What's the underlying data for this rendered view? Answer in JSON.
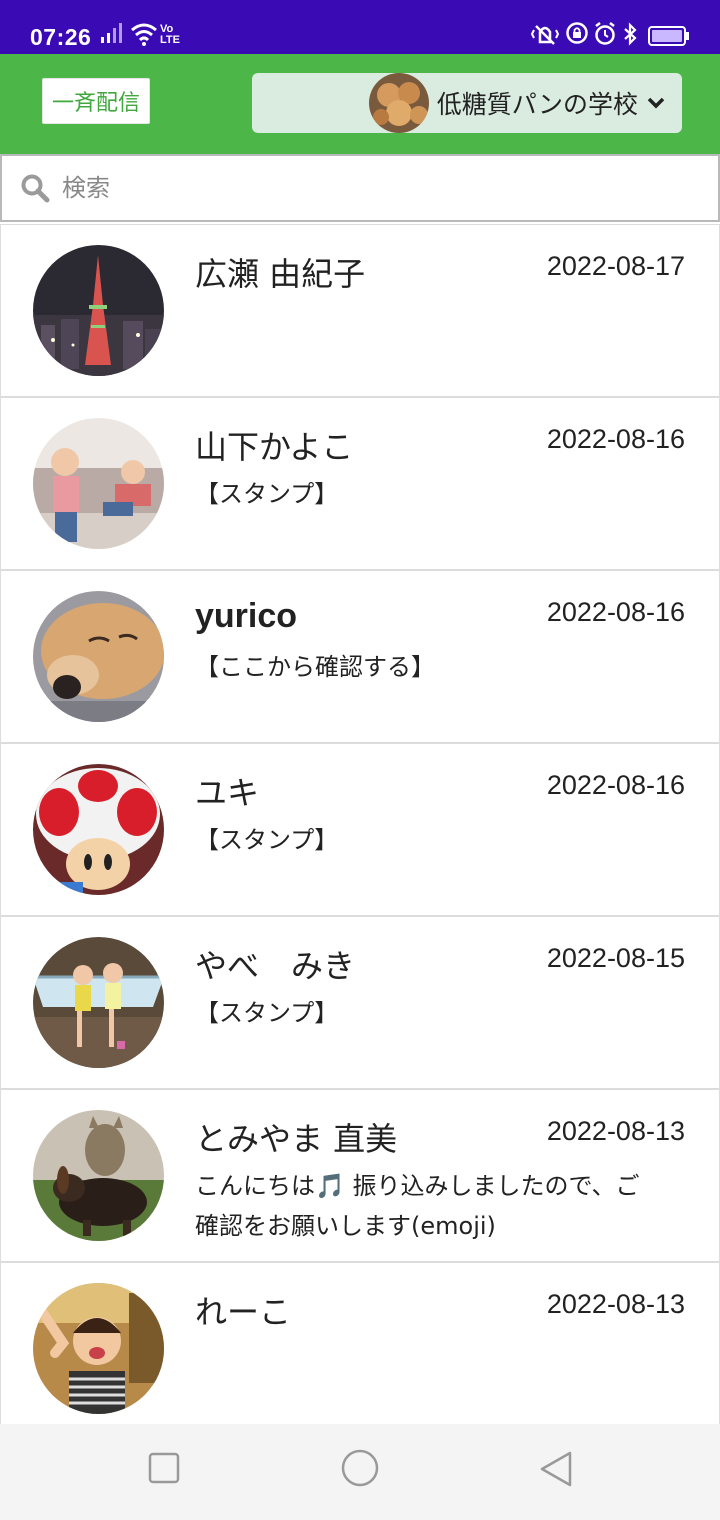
{
  "status_bar": {
    "time": "07:26",
    "volte_line1": "Vo",
    "volte_line2": "LTE"
  },
  "header": {
    "broadcast_label": "一斉配信",
    "account_name": "低糖質パンの学校"
  },
  "search": {
    "placeholder": "検索"
  },
  "conversations": [
    {
      "name": "広瀬 由紀子",
      "date": "2022-08-17",
      "preview": ""
    },
    {
      "name": "山下かよこ",
      "date": "2022-08-16",
      "preview": "【スタンプ】"
    },
    {
      "name": "yurico",
      "date": "2022-08-16",
      "preview": "【ここから確認する】"
    },
    {
      "name": "ユキ",
      "date": "2022-08-16",
      "preview": "【スタンプ】"
    },
    {
      "name": "やべ　みき",
      "date": "2022-08-15",
      "preview": "【スタンプ】"
    },
    {
      "name": "とみやま 直美",
      "date": "2022-08-13",
      "preview": "こんにちは🎵 振り込みしましたので、ご確認をお願いします(emoji)"
    },
    {
      "name": "れーこ",
      "date": "2022-08-13",
      "preview": ""
    }
  ],
  "colors": {
    "status_bar": "#3a0ab4",
    "header_green": "#4cb748",
    "account_bg": "#daece0"
  }
}
